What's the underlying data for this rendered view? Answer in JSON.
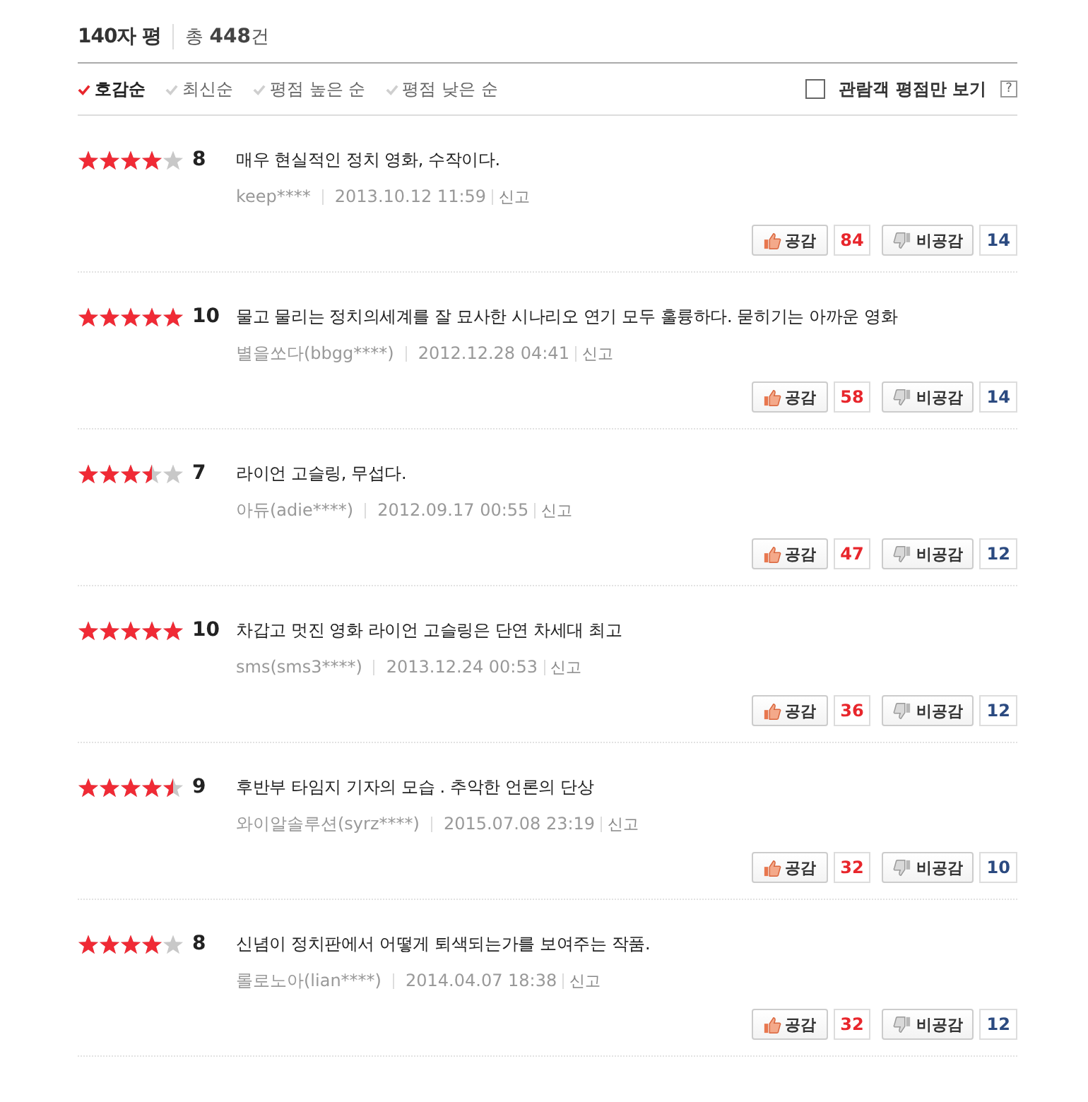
{
  "header": {
    "title": "140자 평",
    "total_prefix": "총",
    "total_count": "448",
    "total_suffix": "건"
  },
  "sort_tabs": [
    {
      "label": "호감순",
      "selected": true
    },
    {
      "label": "최신순",
      "selected": false
    },
    {
      "label": "평점 높은 순",
      "selected": false
    },
    {
      "label": "평점 낮은 순",
      "selected": false
    }
  ],
  "audience_filter": {
    "label": "관람객 평점만 보기",
    "checked": false,
    "help": "?"
  },
  "reviews": [
    {
      "stars": 4,
      "score": "8",
      "text": "매우 현실적인 정치 영화, 수작이다.",
      "author": "keep****",
      "date": "2013.10.12 11:59",
      "report": "신고",
      "like_label": "공감",
      "likes": "84",
      "dislike_label": "비공감",
      "dislikes": "14"
    },
    {
      "stars": 5,
      "score": "10",
      "text": "물고 물리는 정치의세계를 잘 묘사한 시나리오 연기 모두 훌륭하다. 묻히기는 아까운 영화",
      "author": "별을쏘다(bbgg****)",
      "date": "2012.12.28 04:41",
      "report": "신고",
      "like_label": "공감",
      "likes": "58",
      "dislike_label": "비공감",
      "dislikes": "14"
    },
    {
      "stars": 3.5,
      "score": "7",
      "text": "라이언 고슬링, 무섭다.",
      "author": "아듀(adie****)",
      "date": "2012.09.17 00:55",
      "report": "신고",
      "like_label": "공감",
      "likes": "47",
      "dislike_label": "비공감",
      "dislikes": "12"
    },
    {
      "stars": 5,
      "score": "10",
      "text": "차갑고 멋진 영화 라이언 고슬링은 단연 차세대 최고",
      "author": "sms(sms3****)",
      "date": "2013.12.24 00:53",
      "report": "신고",
      "like_label": "공감",
      "likes": "36",
      "dislike_label": "비공감",
      "dislikes": "12"
    },
    {
      "stars": 4.5,
      "score": "9",
      "text": "후반부 타임지 기자의 모습 . 추악한 언론의 단상",
      "author": "와이알솔루션(syrz****)",
      "date": "2015.07.08 23:19",
      "report": "신고",
      "like_label": "공감",
      "likes": "32",
      "dislike_label": "비공감",
      "dislikes": "10"
    },
    {
      "stars": 4,
      "score": "8",
      "text": "신념이 정치판에서 어떻게 퇴색되는가를 보여주는 작품.",
      "author": "롤로노아(lian****)",
      "date": "2014.04.07 18:38",
      "report": "신고",
      "like_label": "공감",
      "likes": "32",
      "dislike_label": "비공감",
      "dislikes": "12"
    }
  ]
}
